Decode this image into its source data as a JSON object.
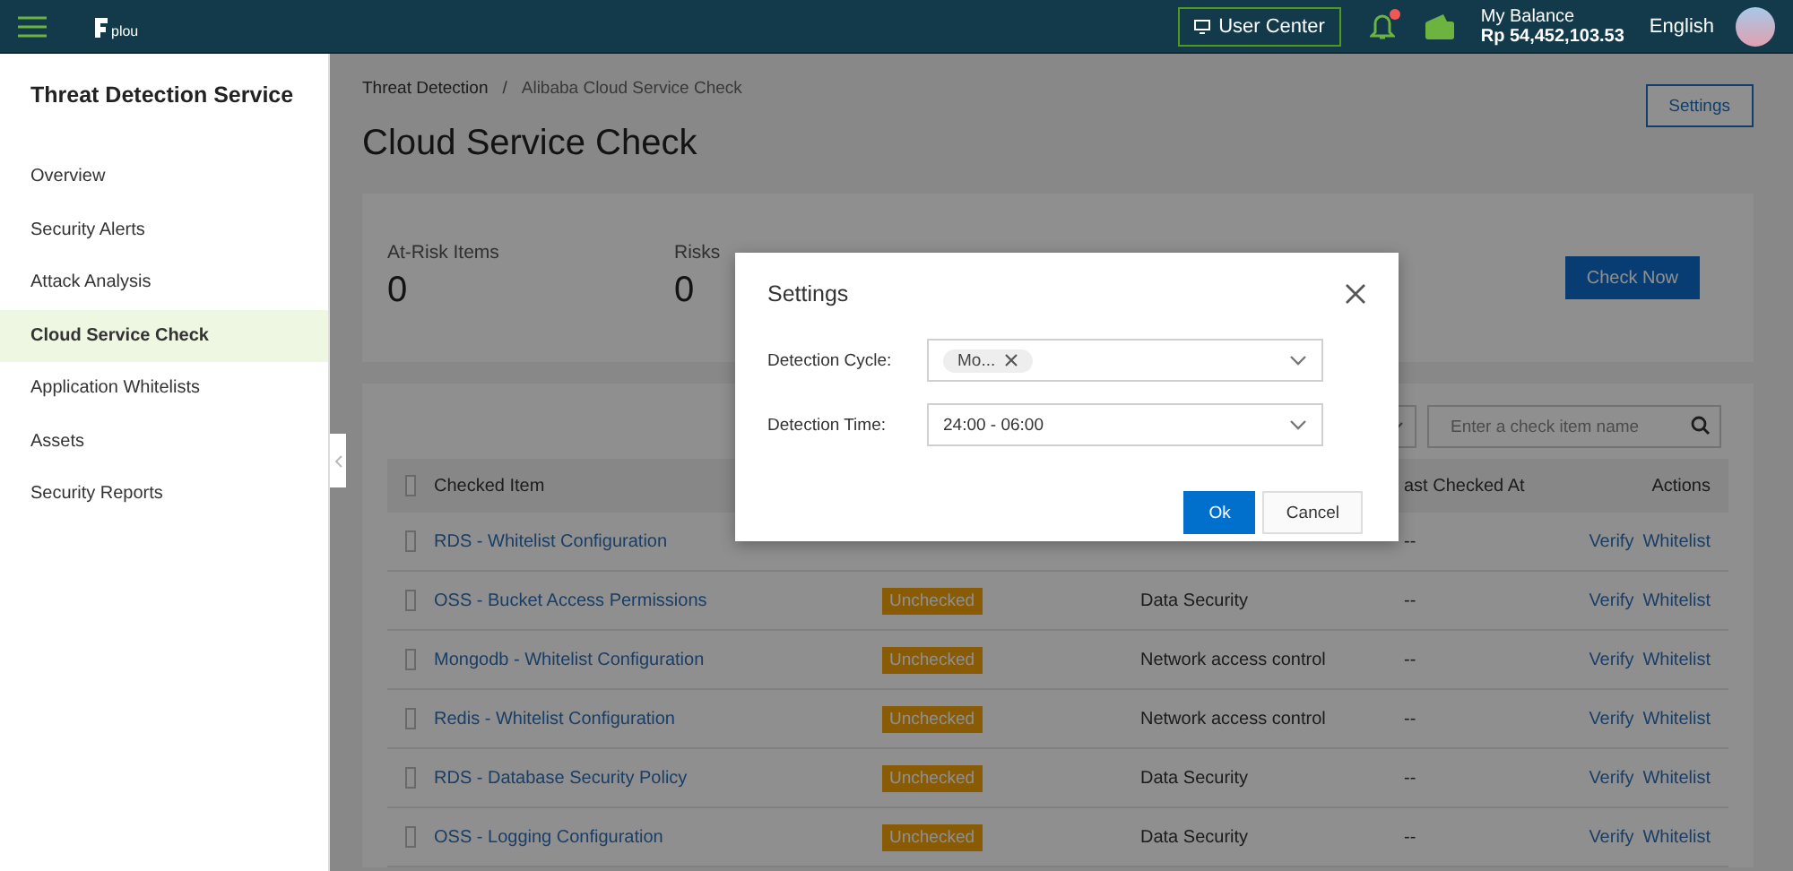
{
  "topbar": {
    "brand": "plou",
    "user_center": "User Center",
    "notification_dot": true,
    "balance_label": "My Balance",
    "balance": "Rp 54,452,103.53",
    "language": "English"
  },
  "sidebar": {
    "title": "Threat Detection Service",
    "items": [
      {
        "label": "Overview",
        "selected": false
      },
      {
        "label": "Security Alerts",
        "selected": false
      },
      {
        "label": "Attack Analysis",
        "selected": false
      },
      {
        "label": "Cloud Service Check",
        "selected": true
      },
      {
        "label": "Application Whitelists",
        "selected": false
      },
      {
        "label": "Assets",
        "selected": false
      },
      {
        "label": "Security Reports",
        "selected": false
      }
    ]
  },
  "breadcrumb": [
    "Threat Detection",
    "Alibaba Cloud Service Check"
  ],
  "breadcrumb_separator": "/",
  "page_title": "Cloud Service Check",
  "settings_button": "Settings",
  "stats": [
    {
      "label": "At-Risk Items",
      "value": "0"
    },
    {
      "label": "Risks",
      "value": "0"
    }
  ],
  "check_now": "Check Now",
  "search": {
    "placeholder": "Enter a check item name"
  },
  "table": {
    "columns": [
      "Checked Item",
      "ast Checked At",
      "Actions"
    ],
    "header_checked": false,
    "rows": [
      {
        "checked": false,
        "item": "RDS - Whitelist Configuration",
        "last_checked": "--",
        "actions": [
          "Verify",
          "Whitelist"
        ]
      },
      {
        "checked": false,
        "item": "OSS - Bucket Access Permissions",
        "status": "Unchecked",
        "category": "Data Security",
        "last_checked": "--",
        "actions": [
          "Verify",
          "Whitelist"
        ]
      },
      {
        "checked": false,
        "item": "Mongodb - Whitelist Configuration",
        "status": "Unchecked",
        "category": "Network access control",
        "last_checked": "--",
        "actions": [
          "Verify",
          "Whitelist"
        ]
      },
      {
        "checked": false,
        "item": "Redis - Whitelist Configuration",
        "status": "Unchecked",
        "category": "Network access control",
        "last_checked": "--",
        "actions": [
          "Verify",
          "Whitelist"
        ]
      },
      {
        "checked": false,
        "item": "RDS - Database Security Policy",
        "status": "Unchecked",
        "category": "Data Security",
        "last_checked": "--",
        "actions": [
          "Verify",
          "Whitelist"
        ]
      },
      {
        "checked": false,
        "item": "OSS - Logging Configuration",
        "status": "Unchecked",
        "category": "Data Security",
        "last_checked": "--",
        "actions": [
          "Verify",
          "Whitelist"
        ]
      }
    ]
  },
  "dialog": {
    "title": "Settings",
    "fields": [
      {
        "label": "Detection Cycle:",
        "kind": "tags",
        "tags": [
          "Mo..."
        ]
      },
      {
        "label": "Detection Time:",
        "kind": "select",
        "value": "24:00 - 06:00"
      }
    ],
    "buttons": [
      {
        "label": "Ok",
        "kind": "primary"
      },
      {
        "label": "Cancel",
        "kind": "default"
      }
    ]
  }
}
